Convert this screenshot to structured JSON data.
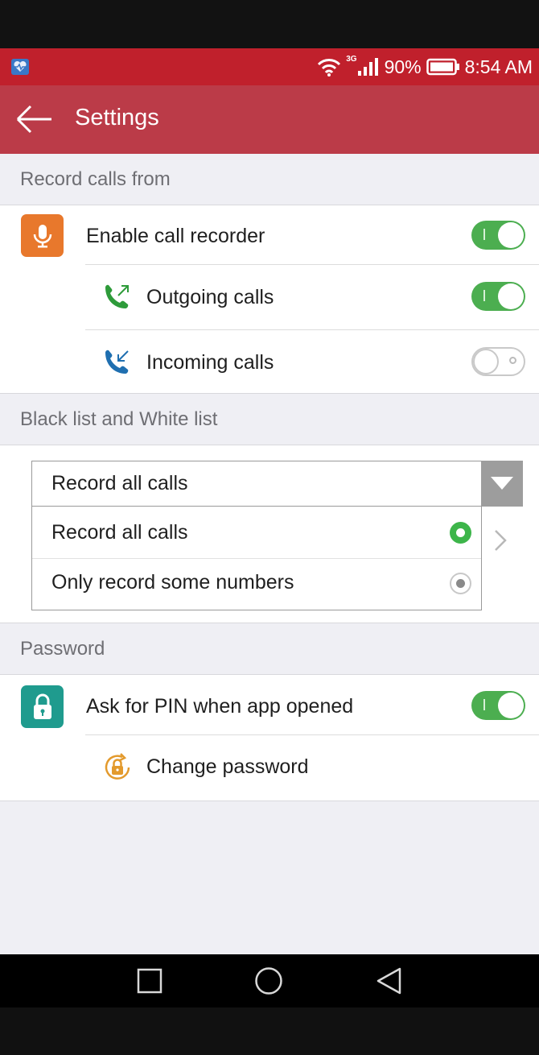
{
  "status_bar": {
    "network": "3G",
    "battery": "90%",
    "time": "8:54 AM",
    "icons": [
      "heart-monitor-app-icon",
      "wifi-icon",
      "signal-icon",
      "battery-icon"
    ]
  },
  "app_bar": {
    "title": "Settings",
    "back_icon": "arrow-left-icon"
  },
  "sections": {
    "record_calls": {
      "header": "Record calls from",
      "enable": {
        "label": "Enable call recorder",
        "on": true,
        "icon": "microphone-icon",
        "icon_bg": "#e8782c"
      },
      "outgoing": {
        "label": "Outgoing calls",
        "on": true,
        "icon": "outgoing-call-icon",
        "icon_color": "#2e9b3a"
      },
      "incoming": {
        "label": "Incoming calls",
        "on": false,
        "icon": "incoming-call-icon",
        "icon_color": "#1f6fb0"
      }
    },
    "lists": {
      "header": "Black list and White list",
      "dropdown_value": "Record all calls",
      "options": [
        {
          "label": "Record all calls",
          "selected": true
        },
        {
          "label": "Only record some numbers",
          "selected": false
        }
      ]
    },
    "password": {
      "header": "Password",
      "pin": {
        "label": "Ask for PIN when app opened",
        "on": true,
        "icon": "lock-icon",
        "icon_bg": "#1f9b8e"
      },
      "change": {
        "label": "Change password",
        "icon": "lock-rotate-icon",
        "icon_color": "#e39a2d"
      }
    }
  },
  "colors": {
    "status_bar": "#c0202c",
    "app_bar": "#bb3b48",
    "toggle_on": "#4cae50",
    "radio_selected": "#3db54a"
  },
  "nav_bar": {
    "icons": [
      "recent-apps-icon",
      "home-icon",
      "back-triangle-icon"
    ]
  }
}
